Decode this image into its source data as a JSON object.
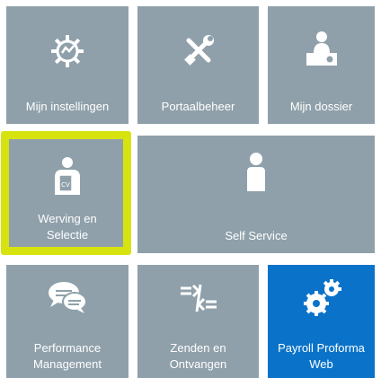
{
  "tiles": [
    {
      "id": "mijn-instellingen",
      "label": "Mijn instellingen",
      "icon": "gear-icon"
    },
    {
      "id": "portaalbeheer",
      "label": "Portaalbeheer",
      "icon": "tools-icon"
    },
    {
      "id": "mijn-dossier",
      "label": "Mijn dossier",
      "icon": "person-desk-icon"
    },
    {
      "id": "werving-en-selectie",
      "label_line1": "Werving en",
      "label_line2": "Selectie",
      "icon": "cv-person-icon",
      "highlighted": true
    },
    {
      "id": "self-service",
      "label": "Self Service",
      "icon": "person-icon"
    },
    {
      "id": "performance-management",
      "label_line1": "Performance",
      "label_line2": "Management",
      "icon": "chat-bubbles-icon"
    },
    {
      "id": "zenden-en-ontvangen",
      "label_line1": "Zenden en",
      "label_line2": "Ontvangen",
      "icon": "send-receive-icon"
    },
    {
      "id": "payroll-proforma-web",
      "label_line1": "Payroll Proforma",
      "label_line2": "Web",
      "icon": "gears-icon",
      "active": true
    }
  ],
  "colors": {
    "tile": "#8fa0aa",
    "tile_active": "#0a73c9",
    "highlight": "#d7e30f",
    "icon": "#ffffff"
  }
}
